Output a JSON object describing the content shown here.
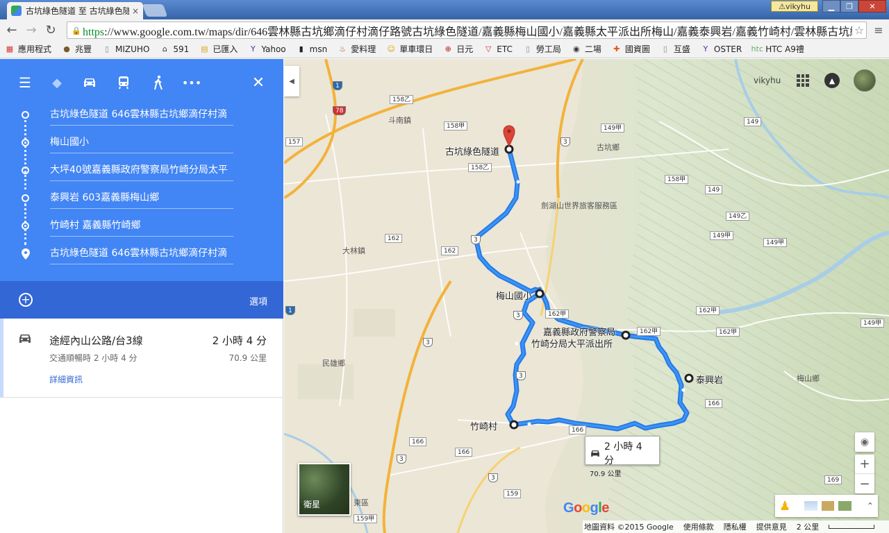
{
  "browser": {
    "tab_title": "古坑綠色隧道 至 古坑綠色隧",
    "tab_close": "×",
    "user_badge": "vikyhu",
    "url_proto": "https",
    "url_rest": "://www.google.com.tw/maps/dir/646雲林縣古坑鄉滴仔村滴仔路號古坑綠色隧道/嘉義縣梅山國小/嘉義縣太平派出所梅山/嘉義泰興岩/嘉義竹崎村/雲林縣古坑綠",
    "bookmarks": [
      "應用程式",
      "兆豐",
      "MIZUHO",
      "591",
      "已匯入",
      "Yahoo",
      "msn",
      "愛料理",
      "單車環日",
      "日元",
      "ETC",
      "勞工局",
      "二場",
      "國資圖",
      "互盛",
      "OSTER",
      "HTC A9禮"
    ]
  },
  "sidebar": {
    "waypoints": [
      "古坑綠色隧道 646雲林縣古坑鄉滴仔村滴",
      "梅山國小",
      "大坪40號嘉義縣政府警察局竹崎分局太平",
      "泰興岩 603嘉義縣梅山鄉",
      "竹崎村 嘉義縣竹崎鄉",
      "古坑綠色隧道 646雲林縣古坑鄉滴仔村滴"
    ],
    "options_label": "選項",
    "route": {
      "via": "途經內山公路/台3線",
      "duration": "2 小時 4 分",
      "traffic": "交通順暢時 2 小時 4 分",
      "distance": "70.9 公里",
      "details_link": "詳細資訊"
    }
  },
  "map": {
    "user_name": "vikyhu",
    "satellite_label": "衛星",
    "route_popup": {
      "duration": "2 小時 4 分",
      "distance": "70.9 公里"
    },
    "footer": {
      "data": "地圖資料 ©2015 Google",
      "terms": "使用條款",
      "privacy": "隱私權",
      "feedback": "提供意見",
      "scale": "2 公里"
    },
    "logo": "Google",
    "places": [
      {
        "name": "古坑綠色隧道",
        "cls": "pin-label"
      },
      {
        "name": "梅山國小",
        "cls": "stop"
      },
      {
        "name": "嘉義縣政府警察局",
        "cls": "stop"
      },
      {
        "name": "竹崎分局大平派出所",
        "cls": "stop"
      },
      {
        "name": "泰興岩",
        "cls": "stop"
      },
      {
        "name": "竹崎村",
        "cls": "stop"
      },
      {
        "name": "劍湖山世界旅客服務區",
        "cls": "poi"
      },
      {
        "name": "斗南鎮",
        "cls": "town"
      },
      {
        "name": "古坑鄉",
        "cls": "town"
      },
      {
        "name": "大林鎮",
        "cls": "town"
      },
      {
        "name": "民雄鄉",
        "cls": "town"
      },
      {
        "name": "梅山鄉",
        "cls": "town"
      },
      {
        "name": "東區",
        "cls": "town"
      }
    ],
    "road_labels": [
      "1",
      "78",
      "158乙",
      "158甲",
      "157",
      "158乙",
      "3",
      "149甲",
      "149",
      "158甲",
      "149",
      "149乙",
      "149甲",
      "149甲",
      "162",
      "162",
      "3",
      "162甲",
      "162甲",
      "162甲",
      "149甲",
      "162甲",
      "1",
      "3",
      "3",
      "166",
      "166",
      "166",
      "166",
      "3",
      "159",
      "159甲",
      "169",
      "3",
      "3"
    ]
  }
}
